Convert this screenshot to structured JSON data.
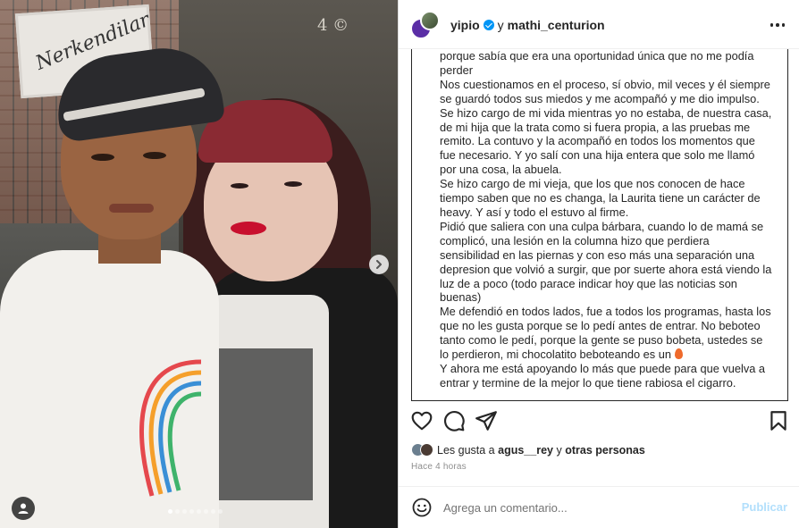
{
  "post": {
    "author": "yipio",
    "author_verified": true,
    "conjunction": "y",
    "coauthor": "mathi_centurion",
    "photo_count": 8,
    "active_photo_index": 0
  },
  "photo": {
    "sign_text": "Nerkendilar",
    "wall_text": "4 ©"
  },
  "caption": {
    "lines": [
      "porque sabía que era una oportunidad única que no me podía perder",
      "Nos cuestionamos en el proceso, sí obvio, mil veces y él siempre se guardó todos sus miedos y me acompañó y me dio impulso. Se hizo cargo de mi vida mientras yo no estaba, de nuestra casa, de mi hija que la trata como si fuera propia, a las pruebas me remito. La contuvo y la acompañó en todos los momentos que fue necesario. Y yo salí con una hija entera que solo me llamó por una cosa, la abuela.",
      "Se hizo cargo de mi vieja, que los que nos conocen de hace tiempo saben que no es changa, la Laurita tiene un carácter de heavy. Y así y todo el estuvo al firme.",
      "Pidió que saliera con una culpa bárbara, cuando lo de mamá se complicó, una lesión en la columna hizo que perdiera sensibilidad en las piernas y con eso más una separación una depresion que volvió a surgir, que por suerte ahora está viendo la luz de a poco (todo parace indicar hoy que las noticias son buenas)",
      "Me defendió en todos lados, fue a todos los programas, hasta los que no les gusta porque se lo pedí antes de entrar. No beboteo tanto como le pedí, porque la gente se puso bobeta, ustedes se lo perdieron, mi chocolatito beboteando es un",
      "Y ahora me está apoyando lo más que puede para que vuelva a entrar y termine de la mejor lo que tiene rabiosa el cigarro."
    ]
  },
  "likes": {
    "prefix": "Les gusta a",
    "user": "agus__rey",
    "middle": "y",
    "others": "otras personas"
  },
  "time_ago": "Hace 4 horas",
  "comment": {
    "placeholder": "Agrega un comentario...",
    "value": "",
    "publish_label": "Publicar"
  },
  "icons": {
    "like": "heart-icon",
    "comment": "comment-bubble-icon",
    "share": "paper-plane-icon",
    "save": "bookmark-icon",
    "emoji": "smiley-icon",
    "next": "chevron-right-icon",
    "tagged": "user-tag-icon",
    "more": "more-dots-icon",
    "verified": "verified-badge-icon"
  },
  "colors": {
    "verified": "#0095f6",
    "publish_disabled": "#b2dffc",
    "muted_text": "#8e8e8e",
    "fire_emoji": "#ef6a2b"
  }
}
